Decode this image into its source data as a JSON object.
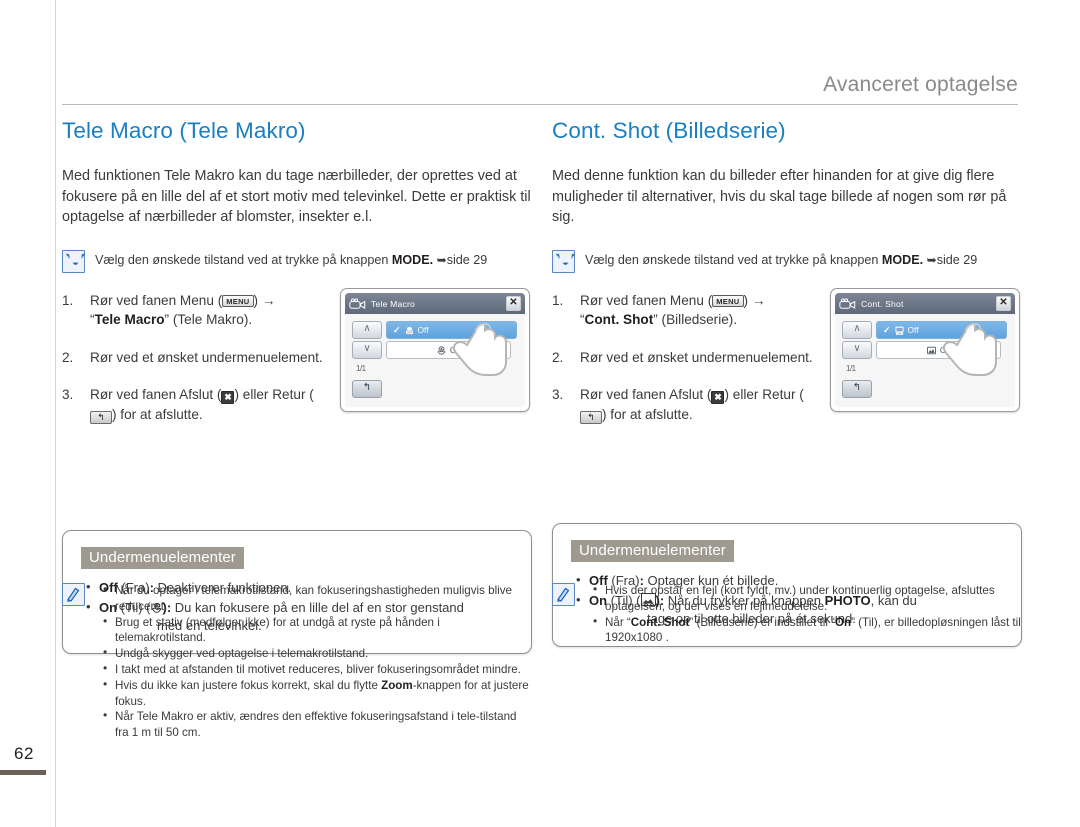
{
  "page": {
    "number": "62",
    "running_head": "Avanceret optagelse"
  },
  "columns": [
    {
      "title": "Tele Macro (Tele Makro)",
      "intro": "Med funktionen Tele Makro kan du tage nærbilleder, der oprettes ved at fokusere på en lille del af et stort motiv med televinkel. Dette er praktisk til optagelse af nærbilleder af blomster, insekter e.l.",
      "tip": {
        "icon": "check-v-icon",
        "text_before": "Vælg den ønskede tilstand ved at trykke på knappen ",
        "bold": "MODE.",
        "arrow": "➥",
        "text_after": "side 29"
      },
      "steps": [
        {
          "num": "1.",
          "pre": "Rør ved fanen Menu (",
          "icon1": "MENU",
          "mid": ") →",
          "line2_quote_open": "“",
          "line2_bold": "Tele Macro",
          "line2_rest": "” (Tele Makro)."
        },
        {
          "num": "2.",
          "text": "Rør ved et ønsket undermenuelement."
        },
        {
          "num": "3.",
          "pre": "Rør ved fanen Afslut (",
          "icon_x": "✖",
          "mid": ") eller Retur (",
          "icon_ret": "↰",
          "post": ") for at afslutte."
        }
      ],
      "lcd": {
        "title": "Tele Macro",
        "title_icon": "camcorder-icon",
        "close_icon": "✕",
        "up_icon": "∧",
        "down_icon": "∨",
        "page_indicator": "1/1",
        "back_icon": "↰",
        "option_selected": {
          "check": "✓",
          "icon": "tele-macro-off-icon",
          "label": "Off"
        },
        "option_unselected": {
          "icon": "tele-macro-on-icon",
          "label": "On"
        }
      },
      "submenu": {
        "heading": "Undermenuelementer",
        "items": [
          {
            "bold": "Off",
            "paren": " (Fra)",
            "colon": ": ",
            "rest": "Deaktiverer funktionen.",
            "icon": null,
            "cont": null
          },
          {
            "bold": "On",
            "paren": " (Til) (",
            "icon": "flower-macro-icon",
            "colon": "): ",
            "rest": "Du kan fokusere på en lille del af en stor genstand",
            "cont": "med en televinkel."
          }
        ]
      },
      "notes": {
        "icon": "note-pen-icon",
        "items": [
          "Når du optager i telemakrotilstand, kan fokuseringshastigheden muligvis blive reduceret.",
          "Brug et stativ (medfølger ikke) for at undgå at ryste på hånden i telemakrotilstand.",
          "Undgå skygger ved optagelse i telemakrotilstand.",
          "I takt med at afstanden til motivet reduceres, bliver fokuseringsområdet mindre.",
          "Hvis du ikke kan justere fokus korrekt, skal du flytte Zoom-knappen for at justere fokus.",
          "Når Tele Makro er aktiv, ændres den effektive fokuseringsafstand i tele-tilstand fra 1 m til 50 cm."
        ],
        "bold_terms": [
          "Zoom"
        ]
      }
    },
    {
      "title": "Cont. Shot (Billedserie)",
      "intro": "Med denne funktion kan du billeder efter hinanden for at give dig flere muligheder til alternativer, hvis du skal tage billede af nogen som rør på sig.",
      "tip": {
        "icon": "check-v-icon",
        "text_before": "Vælg den ønskede tilstand ved at trykke på knappen ",
        "bold": "MODE.",
        "arrow": "➥",
        "text_after": "side 29"
      },
      "steps": [
        {
          "num": "1.",
          "pre": "Rør ved fanen Menu (",
          "icon1": "MENU",
          "mid": ") →",
          "line2_quote_open": "“",
          "line2_bold": "Cont. Shot",
          "line2_rest": "” (Billedserie)."
        },
        {
          "num": "2.",
          "text": "Rør ved et ønsket undermenuelement."
        },
        {
          "num": "3.",
          "pre": "Rør ved fanen Afslut (",
          "icon_x": "✖",
          "mid": ") eller Retur (",
          "icon_ret": "↰",
          "post": ") for at afslutte."
        }
      ],
      "lcd": {
        "title": "Cont. Shot",
        "title_icon": "camcorder-icon",
        "close_icon": "✕",
        "up_icon": "∧",
        "down_icon": "∨",
        "page_indicator": "1/1",
        "back_icon": "↰",
        "option_selected": {
          "check": "✓",
          "icon": "cont-shot-off-icon",
          "label": "Off"
        },
        "option_unselected": {
          "icon": "cont-shot-on-icon",
          "label": "On"
        }
      },
      "submenu": {
        "heading": "Undermenuelementer",
        "items": [
          {
            "bold": "Off",
            "paren": " (Fra)",
            "colon": ": ",
            "rest": "Optager kun ét billede.",
            "icon": null,
            "cont": null
          },
          {
            "bold": "On",
            "paren": " (Til) (",
            "icon": "photo-burst-icon",
            "colon": "): ",
            "rest": "Når du trykker på knappen PHOTO, kan du",
            "cont": "tage op til otte billeder på ét sekund."
          }
        ]
      },
      "notes": {
        "icon": "note-pen-icon",
        "items": [
          "Hvis der opstår en fejl (kort fyldt, mv.) under kontinuerlig optagelse, afsluttes optagelsen, og der vises en fejlmeddelelse.",
          "Når “Cont. Shot” (Billedserie) er indstillet til “On” (Til), er billedopløsningen låst til 1920x1080 ."
        ]
      }
    }
  ],
  "colors": {
    "heading_blue": "#1a7fc1",
    "running_head_gray": "#8a8a8a",
    "submenu_head_bg": "#9e9a90",
    "lcd_title_bg": "#5d6878",
    "lcd_selected_blue": "#5fa2dd",
    "page_bar": "#6b6257"
  }
}
